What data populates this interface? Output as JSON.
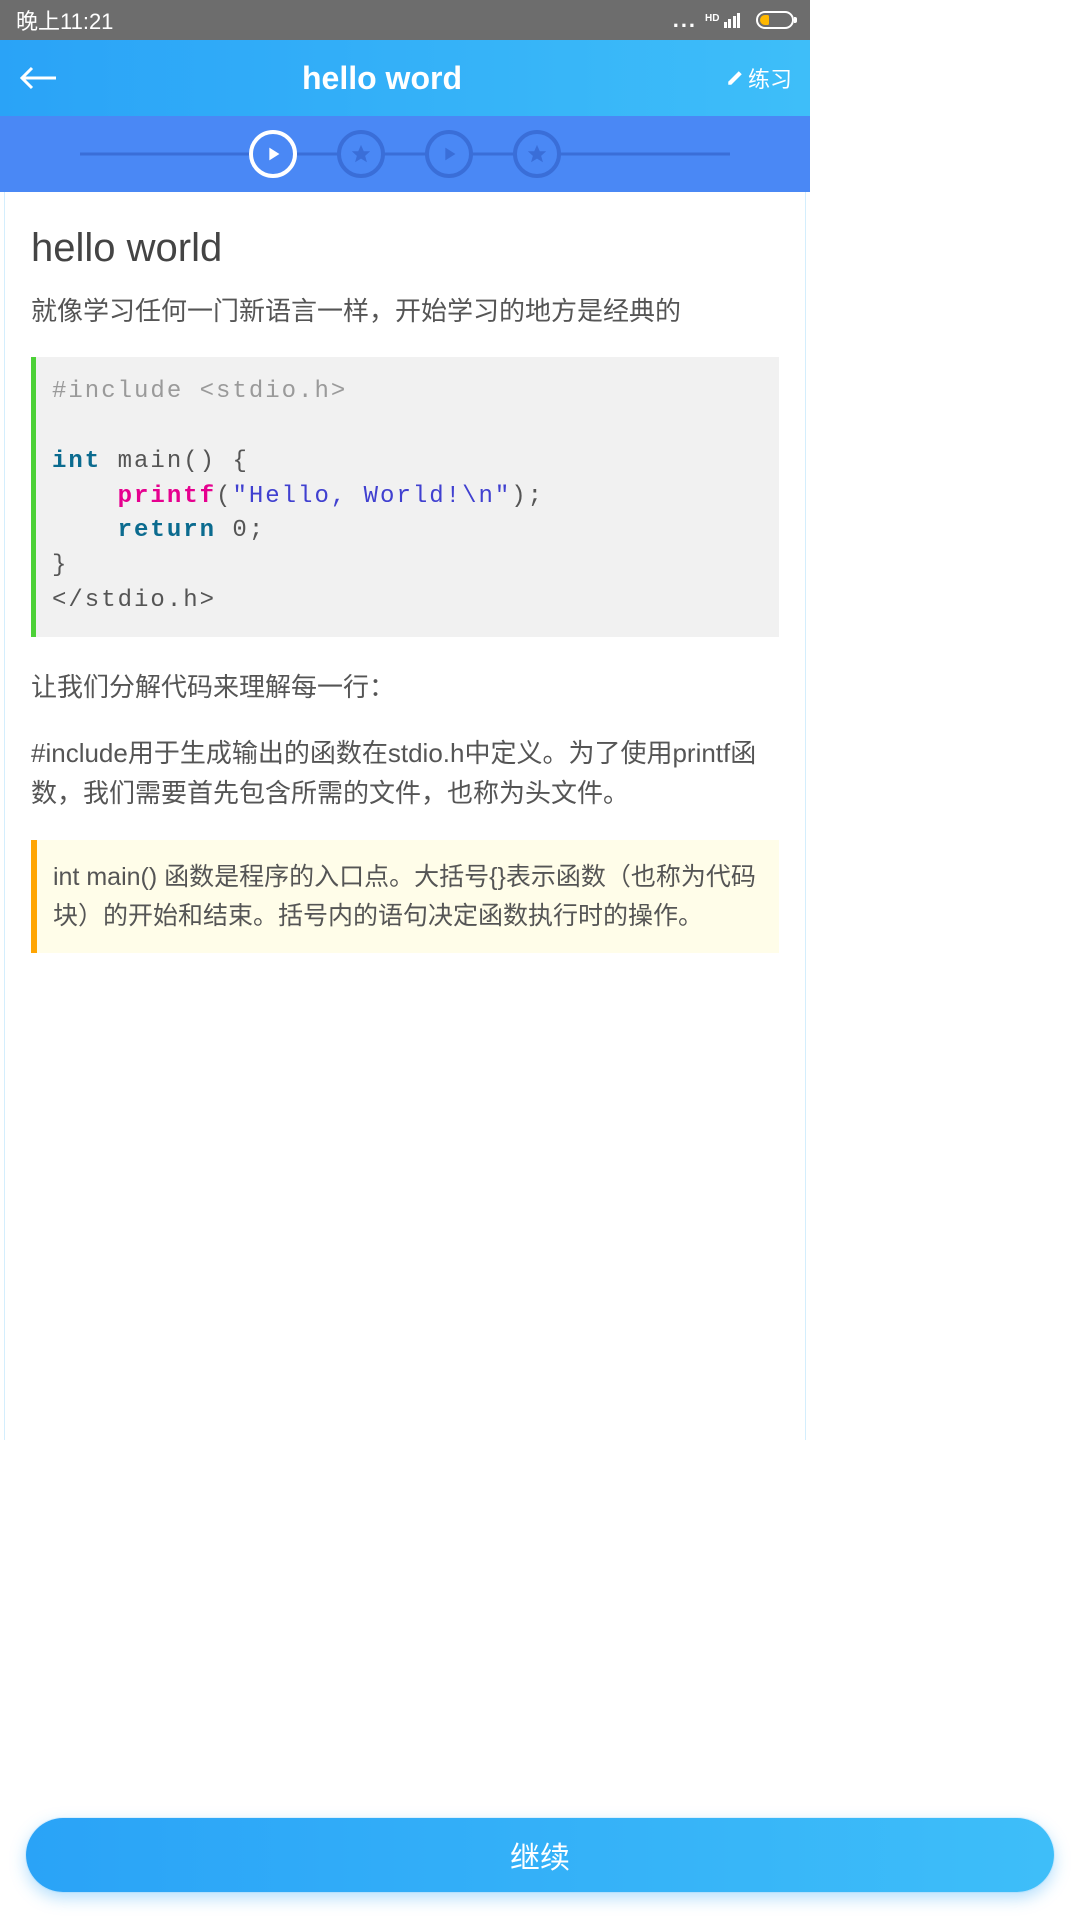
{
  "status": {
    "time": "晚上11:21",
    "hd": "HD"
  },
  "header": {
    "title": "hello word",
    "practice": "练习"
  },
  "content": {
    "title": "hello world",
    "intro": "就像学习任何一门新语言一样，开始学习的地方是经典的",
    "code": {
      "l1a": "#include ",
      "l1b": "<stdio.h>",
      "l2a": "int",
      "l2b": " main() {",
      "l3a": "printf",
      "l3b": "(",
      "l3c": "\"Hello, World!\\n\"",
      "l3d": ");",
      "l4a": "return",
      "l4b": " 0;",
      "l5": "}",
      "l6": "</stdio.h>"
    },
    "para2": "让我们分解代码来理解每一行：",
    "para3": "#include用于生成输出的函数在stdio.h中定义。为了使用printf函数，我们需要首先包含所需的文件，也称为头文件。",
    "note": "int main() 函数是程序的入口点。大括号{}表示函数（也称为代码块）的开始和结束。括号内的语句决定函数执行时的操作。"
  },
  "button": {
    "continue": "继续"
  }
}
